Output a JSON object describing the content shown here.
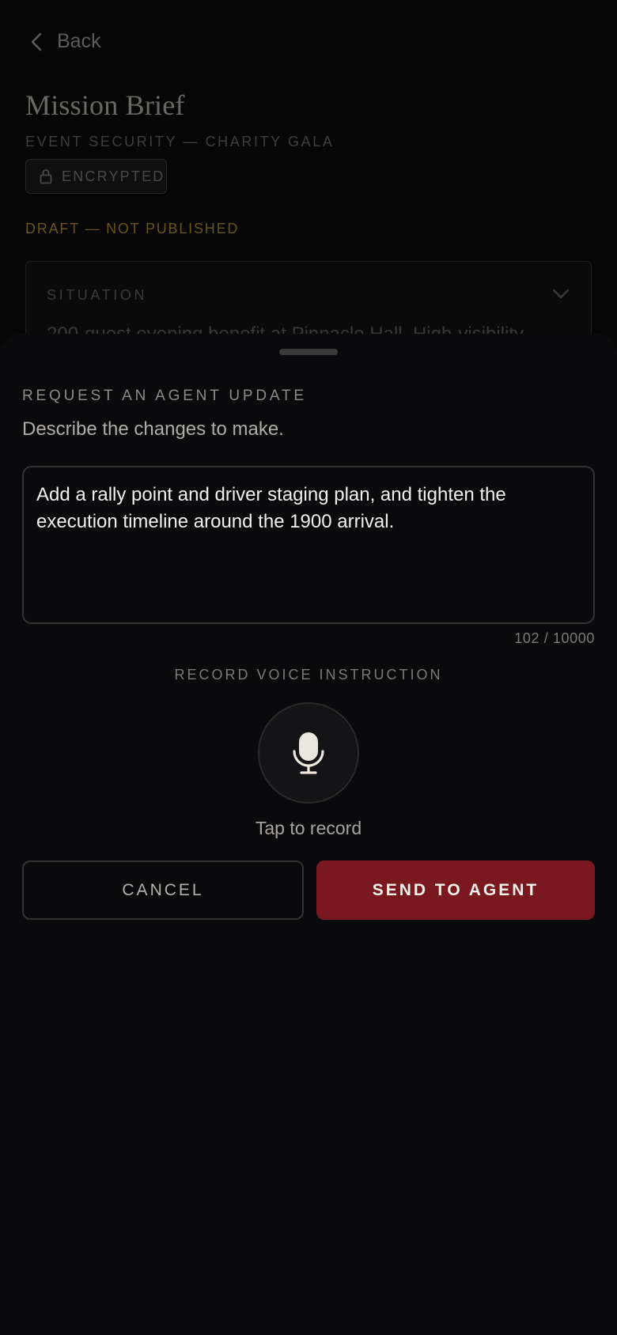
{
  "background": {
    "back_label": "Back",
    "title": "Mission Brief",
    "subtitle": "EVENT SECURITY — CHARITY GALA",
    "encrypted_label": "ENCRYPTED",
    "status": "DRAFT — NOT PUBLISHED",
    "section": {
      "label": "SITUATION",
      "preview_text": "200-guest evening benefit at Pinnacle Hall. High-visibility"
    }
  },
  "sheet": {
    "heading": "REQUEST AN AGENT UPDATE",
    "description": "Describe the changes to make.",
    "instruction_value": "Add a rally point and driver staging plan, and tighten the execution timeline around the 1900 arrival.",
    "char_count": "102 / 10000",
    "voice_label": "RECORD VOICE INSTRUCTION",
    "record_hint": "Tap to record",
    "cancel_label": "CANCEL",
    "send_label": "SEND TO AGENT"
  },
  "colors": {
    "accent": "#7a1820",
    "draft_status": "#6b5418",
    "background": "#060607"
  },
  "icons": [
    "chevron-left-icon",
    "lock-icon",
    "chevron-down-icon",
    "microphone-icon"
  ]
}
